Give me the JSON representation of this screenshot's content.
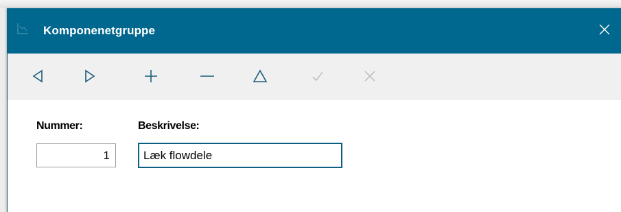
{
  "window": {
    "title": "Komponenetgruppe"
  },
  "icons": {
    "app": "app-icon",
    "close": "close-icon"
  },
  "toolbar": {
    "buttons": [
      {
        "name": "previous",
        "icon": "triangle-left-icon",
        "enabled": true
      },
      {
        "name": "next",
        "icon": "triangle-right-icon",
        "enabled": true
      },
      {
        "name": "add",
        "icon": "plus-icon",
        "enabled": true
      },
      {
        "name": "delete",
        "icon": "minus-icon",
        "enabled": true
      },
      {
        "name": "edit",
        "icon": "triangle-up-icon",
        "enabled": true
      },
      {
        "name": "confirm",
        "icon": "check-icon",
        "enabled": false
      },
      {
        "name": "cancel",
        "icon": "x-icon",
        "enabled": false
      }
    ]
  },
  "form": {
    "number_label": "Nummer:",
    "number_value": "1",
    "description_label": "Beskrivelse:",
    "description_value": "Læk flowdele"
  },
  "colors": {
    "titlebar": "#00678e",
    "enabled_icon": "#1a5d7a",
    "disabled_icon": "#b9b9b9",
    "focus_border": "#0b5f80"
  }
}
